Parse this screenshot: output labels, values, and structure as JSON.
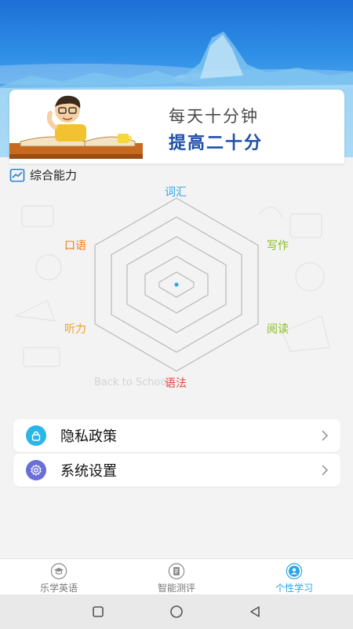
{
  "banner": {
    "line1": "每天十分钟",
    "line2": "提高二十分"
  },
  "section": {
    "title": "综合能力",
    "icon": "chart-trend-icon"
  },
  "radar": {
    "labels": {
      "top": "词汇",
      "top_right": "写作",
      "bottom_right": "阅读",
      "bottom": "语法",
      "bottom_left": "听力",
      "top_left": "口语"
    },
    "colors": {
      "vocabulary": "#2aa4e6",
      "writing": "#8dbb22",
      "reading": "#8dbb22",
      "grammar": "#e0463a",
      "listening": "#f0a020",
      "speaking": "#f07a20"
    },
    "watermark": "Back to School"
  },
  "menu": [
    {
      "label": "隐私政策",
      "icon": "lock-icon",
      "color": "#2bb6e9"
    },
    {
      "label": "系统设置",
      "icon": "gear-icon",
      "color": "#6a6fd8"
    }
  ],
  "tabs": [
    {
      "label": "乐学英语",
      "icon": "graduation-cap-icon",
      "active": false
    },
    {
      "label": "智能测评",
      "icon": "document-icon",
      "active": false
    },
    {
      "label": "个性学习",
      "icon": "user-icon",
      "active": true
    }
  ],
  "accent": "#2aa4e6"
}
